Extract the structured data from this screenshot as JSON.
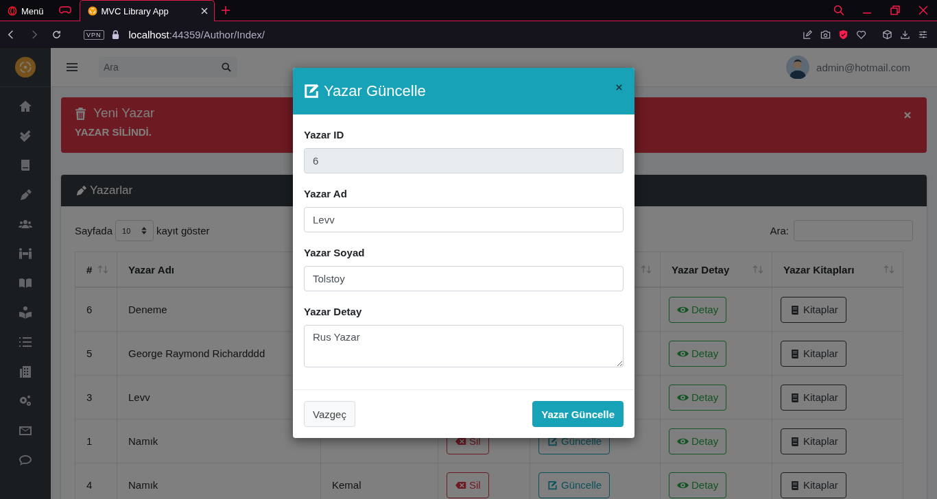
{
  "browser": {
    "tabs": [
      {
        "label": "Menü",
        "selected": false,
        "kind": "menu"
      },
      {
        "label": "MVC Library App",
        "selected": true,
        "kind": "page"
      }
    ],
    "vpn_badge": "VPN",
    "address": {
      "host": "localhost",
      "path": ":44359/Author/Index/"
    }
  },
  "topbar": {
    "search_placeholder": "Ara",
    "user": "admin@hotmail.com"
  },
  "alert": {
    "title": "Yeni Yazar",
    "message": "YAZAR SİLİNDİ."
  },
  "card": {
    "title": "Yazarlar",
    "length_before": "Sayfada",
    "page_size": "10",
    "length_after": "kayıt göster",
    "search_label": "Ara:"
  },
  "table": {
    "columns": [
      {
        "label": "#"
      },
      {
        "label": "Yazar Adı"
      },
      {
        "label": "Yazar Detay"
      },
      {
        "label": "Yazar Kitapları"
      }
    ],
    "rows": [
      {
        "id": "6",
        "name": "Deneme",
        "detail_button": "Detay",
        "books_button": "Kitaplar"
      },
      {
        "id": "5",
        "name": "George Raymond Richardddd",
        "detail_button": "Detay",
        "books_button": "Kitaplar"
      },
      {
        "id": "3",
        "name": "Levv",
        "detail_button": "Detay",
        "books_button": "Kitaplar"
      },
      {
        "id": "1",
        "name": "Namık",
        "delete_button": "Sil",
        "update_button": "Güncelle",
        "detail_button": "Detay",
        "books_button": "Kitaplar"
      },
      {
        "id": "4",
        "name": "Namık",
        "surname": "Kemal",
        "delete_button": "Sil",
        "update_button": "Güncelle",
        "detail_button": "Detay",
        "books_button": "Kitaplar"
      }
    ]
  },
  "modal": {
    "title": "Yazar Güncelle",
    "fields": [
      {
        "label": "Yazar ID",
        "value": "6",
        "disabled": true,
        "kind": "input"
      },
      {
        "label": "Yazar Ad",
        "value": "Levv",
        "disabled": false,
        "kind": "input"
      },
      {
        "label": "Yazar Soyad",
        "value": "Tolstoy",
        "disabled": false,
        "kind": "input"
      },
      {
        "label": "Yazar Detay",
        "value": "Rus Yazar",
        "disabled": false,
        "kind": "textarea"
      }
    ],
    "cancel_button": "Vazgeç",
    "submit_button": "Yazar Güncelle"
  }
}
